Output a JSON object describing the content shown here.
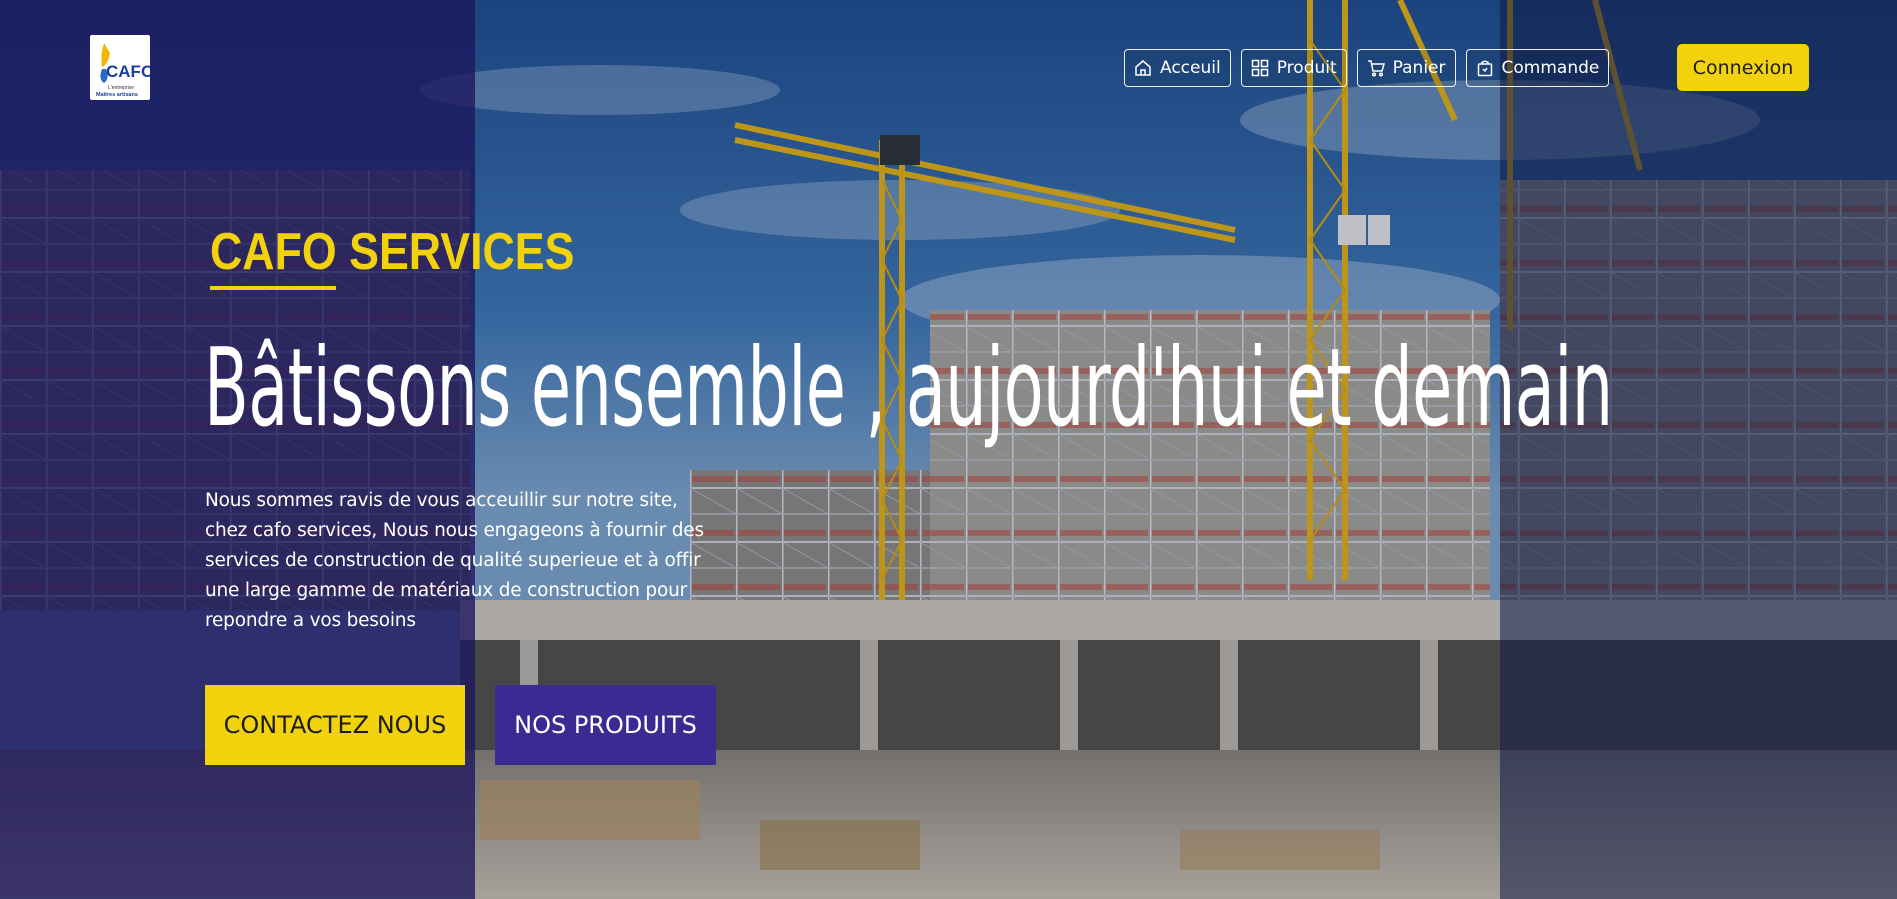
{
  "logo": {
    "text": "CAFO",
    "caption_line1": "L'entreprise",
    "caption_line2": "Maîtres artisans"
  },
  "nav": {
    "items": [
      {
        "label": "Acceuil",
        "icon": "home-icon"
      },
      {
        "label": "Produit",
        "icon": "grid-icon"
      },
      {
        "label": "Panier",
        "icon": "cart-icon"
      },
      {
        "label": "Commande",
        "icon": "bag-icon"
      }
    ],
    "login_label": "Connexion"
  },
  "hero": {
    "brand": "CAFO SERVICES",
    "headline": "Bâtissons ensemble , aujourd'hui et demain",
    "intro": "Nous sommes ravis de vous acceuillir sur notre site, chez cafo services, Nous nous engageons à fournir des services de construction de qualité superieue et à offir une large gamme de matériaux de construction pour repondre a vos besoins",
    "contact_label": "CONTACTEZ NOUS",
    "products_label": "NOS PRODUITS"
  },
  "colors": {
    "accent_yellow": "#f2d20c",
    "accent_purple": "#3a2a92",
    "overlay_left": "#1c165c"
  }
}
